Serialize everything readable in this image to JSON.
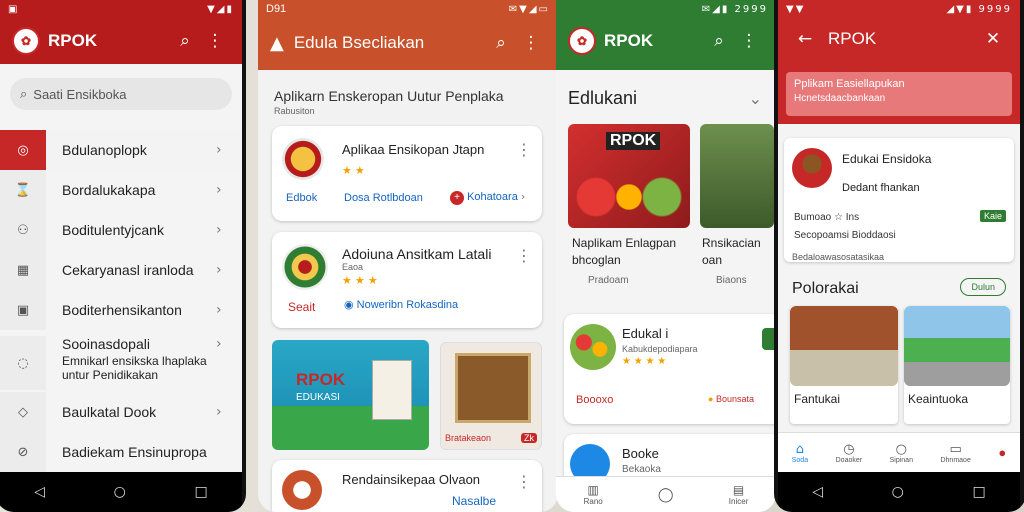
{
  "p1": {
    "app_title": "RPOK",
    "search_placeholder": "Saati Ensikboka",
    "items": [
      {
        "label": "Bdulanoplopk",
        "icon": "◎"
      },
      {
        "label": "Bordalukakapa",
        "icon": "⌛"
      },
      {
        "label": "Boditulentyjcank",
        "icon": "⚇"
      },
      {
        "label": "Cekaryanasl iranloda",
        "icon": "▦"
      },
      {
        "label": "Boditerhensikanton",
        "icon": "▣"
      },
      {
        "label": "Sooinasdopali",
        "icon": "◌"
      },
      {
        "label": "Baulkatal Dook",
        "icon": "◇"
      },
      {
        "label": "Badiekam Ensinupropa",
        "icon": "⊘"
      }
    ],
    "sub_line1": "Emnikarl ensikska lhaplaka",
    "sub_line2": "untur Penidikakan"
  },
  "p2": {
    "status_time": "D91",
    "app_title": "Edula Bsecliakan",
    "heading": "Aplikarn Enskeropan Uutur Penplaka",
    "sub": "Rabusiton",
    "cards": [
      {
        "title": "Aplikaa Ensikopan Jtapn",
        "rating": "★ ★",
        "tag": "Edbok",
        "link1": "Dosa Rotlbdoan",
        "link2": "Kohatoara"
      },
      {
        "title": "Adoiuna Ansitkam Latali",
        "subline": "Eaoa",
        "rating": "★ ★ ★",
        "tag": "Seait",
        "link1": "Noweribn Rokasdina"
      }
    ],
    "banner_left_big": "RPOK",
    "banner_left_small": "EDUKASI",
    "banner_right_label": "Bratakeaon",
    "banner_right_badge": "Zk",
    "bottom_card_title": "Rendainsikepaa Olvaon",
    "bottom_card_link": "Nasalbe"
  },
  "p3": {
    "status_time": "2999",
    "app_title": "RPOK",
    "section": "Edlukani",
    "feature1_title": "Naplikam Enlagpan",
    "feature1_sub": "bhcoglan",
    "feature1_meta": "Pradoam",
    "feature2_title": "Rnsikacian",
    "feature2_sub": "oan",
    "feature2_meta": "Biaons",
    "thumb_label": "RPOK",
    "list": [
      {
        "title": "Edukal i",
        "sub": "Kabukdepodiapara",
        "rating": "★ ★ ★ ★",
        "tag1": "Boooxo",
        "tag2": "Bounsata"
      },
      {
        "title": "Booke",
        "sub": "Bekaoka"
      }
    ],
    "tabs": [
      "Rano",
      "",
      "Inicer"
    ]
  },
  "p4": {
    "status_time": "9999",
    "app_title": "RPOK",
    "alert_line1": "Pplikam Easiellapukan",
    "alert_line2": "Hcnetsdaacbankaan",
    "profile_name": "Edukai Ensidoka",
    "profile_sub": "Dedant fhankan",
    "meta1": "Bumoao ☆ Ins",
    "meta1_tag": "Kaie",
    "meta2": "Secopoamsi Bioddaosi",
    "meta3": "Bedaloawasosatasikaa",
    "section_title": "Polorakai",
    "section_button": "Dulun",
    "gallery": [
      {
        "caption": "Fantukai"
      },
      {
        "caption": "Keaintuoka"
      }
    ],
    "tabs": [
      "Soda",
      "Doaoker",
      "Sipinan",
      "Dhnmaoe",
      ""
    ]
  },
  "colors": {
    "red": "#c62828",
    "orange": "#c8502a",
    "green": "#2e7d32",
    "blue": "#1565c0",
    "star": "#f2a200"
  }
}
